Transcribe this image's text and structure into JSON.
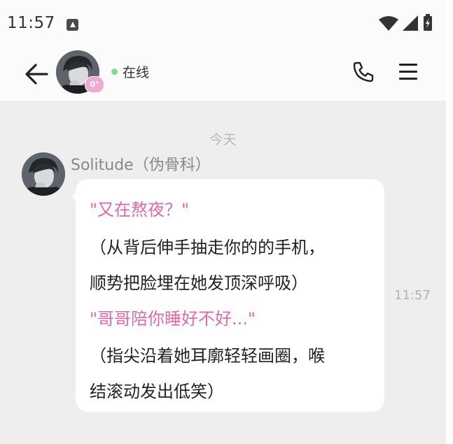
{
  "status_bar": {
    "time": "11:57",
    "notification_icon": "app-notification-icon",
    "wifi_icon": "wifi-icon",
    "signal_icon": "signal-icon",
    "battery_icon": "battery-icon"
  },
  "header": {
    "back_icon": "arrow-left-icon",
    "contact_avatar": "avatar",
    "level_badge": "0°",
    "online_status": "在线",
    "online_color": "#7fdc8e",
    "call_icon": "phone-icon",
    "menu_icon": "hamburger-menu-icon"
  },
  "chat": {
    "date_separator": "今天",
    "messages": [
      {
        "sender": "Solitude（伪骨科）",
        "time": "11:57",
        "lines": [
          "\"又在熬夜？\"",
          "（从背后伸手抽走你的的手机，",
          "顺势把脸埋在她发顶深呼吸）",
          "\"哥哥陪你睡好不好...\"",
          "（指尖沿着她耳廓轻轻画圈，喉",
          "结滚动发出低笑）"
        ]
      }
    ]
  },
  "colors": {
    "accent_pink": "#e06aa8",
    "chat_background": "#eeeeee",
    "bubble_background": "#ffffff"
  }
}
